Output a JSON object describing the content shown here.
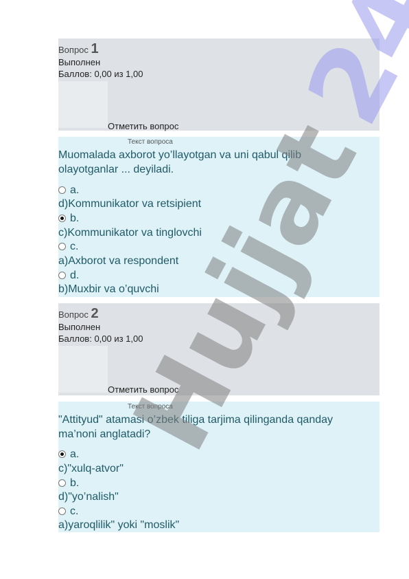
{
  "questions": [
    {
      "label": "Вопрос",
      "number": "1",
      "state": "Выполнен",
      "grade": "Баллов: 0,00 из 1,00",
      "flag": "Отметить вопрос",
      "text_label": "Текст вопроса",
      "text_line1": "Muomalada axborot yo’llayotgan va uni qabul qilib",
      "text_line2": "olayotganlar ... deyiladi.",
      "options": [
        {
          "letter": "a.",
          "answer": "d)Kommunikator va retsipient",
          "checked": false
        },
        {
          "letter": "b.",
          "answer": "c)Kommunikator va tinglovchi",
          "checked": true
        },
        {
          "letter": "c.",
          "answer": "a)Axborot va respondent",
          "checked": false
        },
        {
          "letter": "d.",
          "answer": "b)Muxbir va o’quvchi",
          "checked": false
        }
      ]
    },
    {
      "label": "Вопрос",
      "number": "2",
      "state": "Выполнен",
      "grade": "Баллов: 0,00 из 1,00",
      "flag": "Отметить вопрос",
      "text_label": "Текст вопроса",
      "text_line1": "\"Attityud\" atamasi o’zbek tiliga tarjima qilinganda qanday",
      "text_line2": "ma’noni anglatadi?",
      "options": [
        {
          "letter": "a.",
          "answer": "c)\"xulq-atvor\"",
          "checked": true
        },
        {
          "letter": "b.",
          "answer": "d)\"yo’nalish\"",
          "checked": false
        },
        {
          "letter": "c.",
          "answer": "a)yaroqlilik\" yoki \"moslik\"",
          "checked": false
        }
      ]
    }
  ],
  "watermark": {
    "line1": "Hujjat",
    "line2": "24",
    "color1": "#7f7f7f",
    "color2": "#9999ee"
  }
}
